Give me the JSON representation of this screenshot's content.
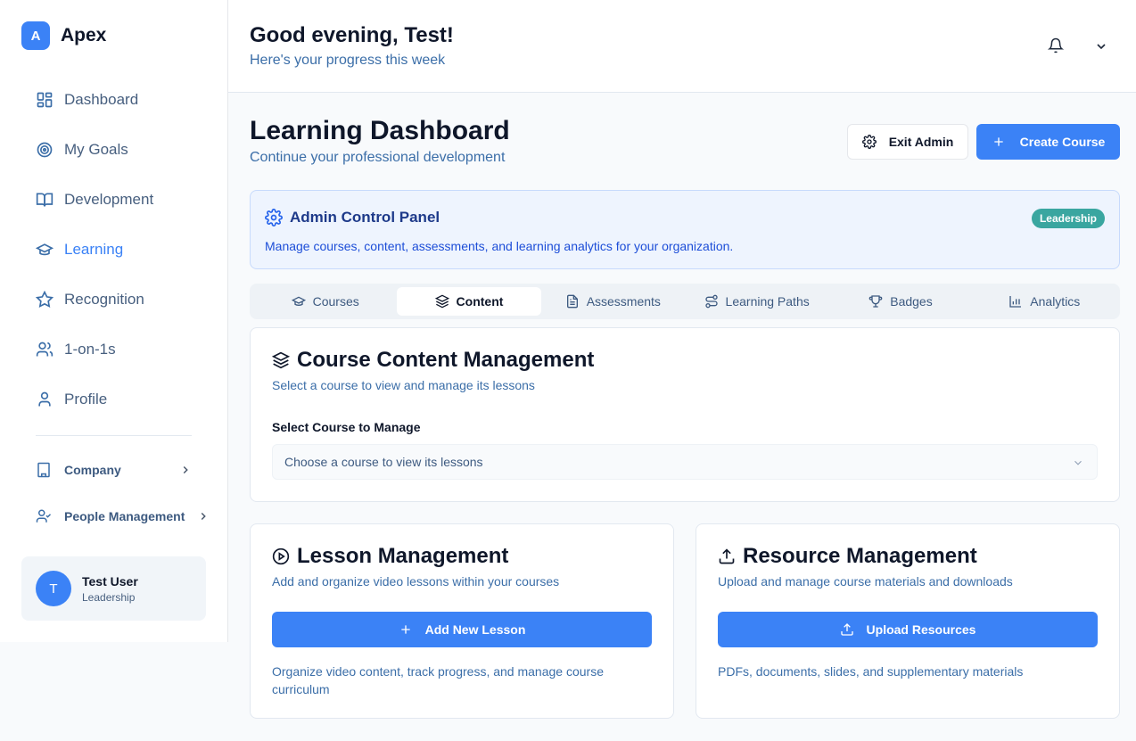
{
  "brand": {
    "logo_letter": "A",
    "name": "Apex"
  },
  "sidebar": {
    "items": [
      {
        "label": "Dashboard",
        "icon": "dashboard-icon"
      },
      {
        "label": "My Goals",
        "icon": "target-icon"
      },
      {
        "label": "Development",
        "icon": "book-icon"
      },
      {
        "label": "Learning",
        "icon": "graduation-cap-icon",
        "active": true
      },
      {
        "label": "Recognition",
        "icon": "star-icon"
      },
      {
        "label": "1-on-1s",
        "icon": "users-icon"
      },
      {
        "label": "Profile",
        "icon": "user-icon"
      }
    ],
    "sections": [
      {
        "label": "Company",
        "icon": "building-icon"
      },
      {
        "label": "People Management",
        "icon": "people-icon"
      }
    ],
    "user": {
      "initial": "T",
      "name": "Test User",
      "role": "Leadership"
    }
  },
  "header": {
    "greeting": "Good evening, Test!",
    "subtitle": "Here's your progress this week"
  },
  "page": {
    "title": "Learning Dashboard",
    "subtitle": "Continue your professional development",
    "exit_admin_label": "Exit Admin",
    "create_course_label": "Create Course"
  },
  "admin_panel": {
    "title": "Admin Control Panel",
    "description": "Manage courses, content, assessments, and learning analytics for your organization.",
    "badge": "Leadership"
  },
  "tabs": [
    {
      "label": "Courses",
      "icon": "graduation-cap-icon"
    },
    {
      "label": "Content",
      "icon": "layers-icon",
      "active": true
    },
    {
      "label": "Assessments",
      "icon": "file-text-icon"
    },
    {
      "label": "Learning Paths",
      "icon": "route-icon"
    },
    {
      "label": "Badges",
      "icon": "trophy-icon"
    },
    {
      "label": "Analytics",
      "icon": "bar-chart-icon"
    }
  ],
  "content_card": {
    "title": "Course Content Management",
    "subtitle": "Select a course to view and manage its lessons",
    "field_label": "Select Course to Manage",
    "select_placeholder": "Choose a course to view its lessons"
  },
  "lesson_card": {
    "title": "Lesson Management",
    "subtitle": "Add and organize video lessons within your courses",
    "button_label": "Add New Lesson",
    "note": "Organize video content, track progress, and manage course curriculum"
  },
  "resource_card": {
    "title": "Resource Management",
    "subtitle": "Upload and manage course materials and downloads",
    "button_label": "Upload Resources",
    "note": "PDFs, documents, slides, and supplementary materials"
  },
  "colors": {
    "accent": "#3b82f6",
    "badge": "#3aa6a0",
    "admin_panel_bg": "#eef4fe"
  }
}
